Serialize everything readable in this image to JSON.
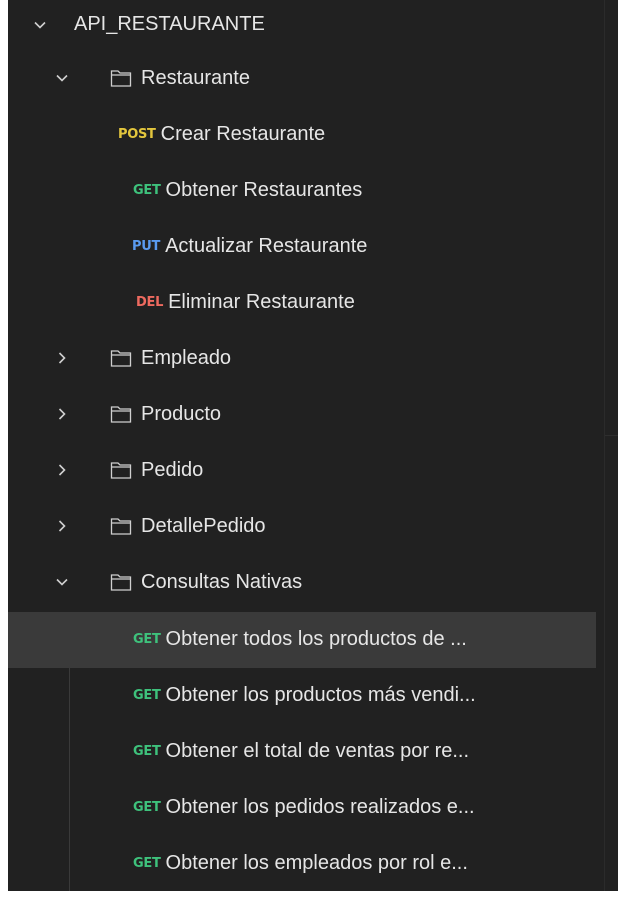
{
  "colors": {
    "background": "#212121",
    "text": "#e6e6e6",
    "selected_row": "#3a3a3a",
    "POST": "#e3c63d",
    "GET": "#3ec27c",
    "PUT": "#5a9bf0",
    "DEL": "#ee6a5f"
  },
  "icons": {
    "expanded": "chevron-down-icon",
    "collapsed": "chevron-right-icon",
    "folder": "folder-icon"
  },
  "collection": {
    "name": "API_RESTAURANTE",
    "expanded": true
  },
  "folders": [
    {
      "name": "Restaurante",
      "expanded": true,
      "requests": [
        {
          "method": "POST",
          "name": "Crear Restaurante"
        },
        {
          "method": "GET",
          "name": "Obtener Restaurantes"
        },
        {
          "method": "PUT",
          "name": "Actualizar Restaurante"
        },
        {
          "method": "DEL",
          "name": "Eliminar Restaurante"
        }
      ]
    },
    {
      "name": "Empleado",
      "expanded": false,
      "requests": []
    },
    {
      "name": "Producto",
      "expanded": false,
      "requests": []
    },
    {
      "name": "Pedido",
      "expanded": false,
      "requests": []
    },
    {
      "name": "DetallePedido",
      "expanded": false,
      "requests": []
    },
    {
      "name": "Consultas Nativas",
      "expanded": true,
      "requests": [
        {
          "method": "GET",
          "name": "Obtener todos los productos de ...",
          "selected": true
        },
        {
          "method": "GET",
          "name": "Obtener los productos más vendi..."
        },
        {
          "method": "GET",
          "name": "Obtener el total de ventas por re..."
        },
        {
          "method": "GET",
          "name": "Obtener los pedidos realizados e..."
        },
        {
          "method": "GET",
          "name": "Obtener los empleados por rol e..."
        }
      ]
    }
  ]
}
